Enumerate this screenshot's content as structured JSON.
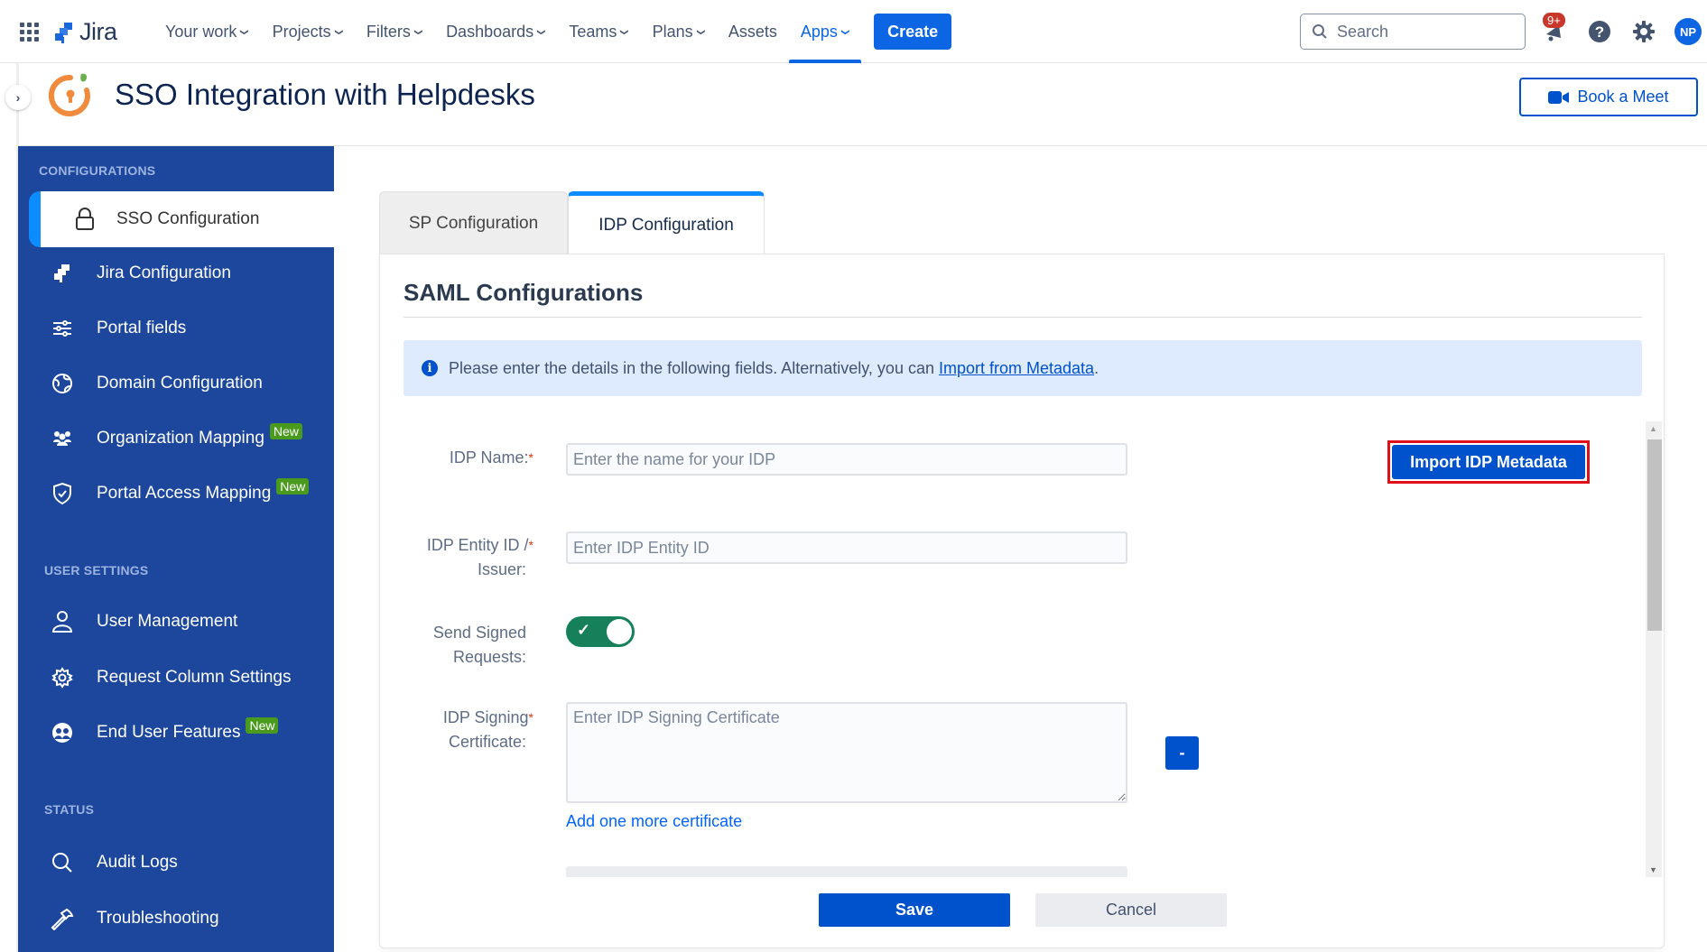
{
  "topnav": {
    "brand": "Jira",
    "items": [
      {
        "label": "Your work",
        "dropdown": true,
        "active": false
      },
      {
        "label": "Projects",
        "dropdown": true,
        "active": false
      },
      {
        "label": "Filters",
        "dropdown": true,
        "active": false
      },
      {
        "label": "Dashboards",
        "dropdown": true,
        "active": false
      },
      {
        "label": "Teams",
        "dropdown": true,
        "active": false
      },
      {
        "label": "Plans",
        "dropdown": true,
        "active": false
      },
      {
        "label": "Assets",
        "dropdown": false,
        "active": false
      },
      {
        "label": "Apps",
        "dropdown": true,
        "active": true
      }
    ],
    "create_label": "Create",
    "search_placeholder": "Search",
    "notifications_badge": "9+",
    "avatar_initials": "NP",
    "accent_color": "#0c66e4"
  },
  "app": {
    "title": "SSO Integration with Helpdesks",
    "book_meet_label": "Book a Meet"
  },
  "sidebar": {
    "sections": [
      {
        "title": "CONFIGURATIONS"
      },
      {
        "title": "USER SETTINGS"
      },
      {
        "title": "STATUS"
      }
    ],
    "items": [
      {
        "label": "SSO Configuration",
        "icon": "lock-icon",
        "active": true,
        "badge": null
      },
      {
        "label": "Jira Configuration",
        "icon": "jira-icon",
        "active": false,
        "badge": null
      },
      {
        "label": "Portal fields",
        "icon": "sliders-icon",
        "active": false,
        "badge": null
      },
      {
        "label": "Domain Configuration",
        "icon": "globe-icon",
        "active": false,
        "badge": null
      },
      {
        "label": "Organization Mapping",
        "icon": "users-group-icon",
        "active": false,
        "badge": "New"
      },
      {
        "label": "Portal Access Mapping",
        "icon": "shield-check-icon",
        "active": false,
        "badge": "New"
      },
      {
        "label": "User Management",
        "icon": "user-icon",
        "active": false,
        "badge": null
      },
      {
        "label": "Request Column Settings",
        "icon": "gear-icon",
        "active": false,
        "badge": null
      },
      {
        "label": "End User Features",
        "icon": "end-user-icon",
        "active": false,
        "badge": "New"
      },
      {
        "label": "Audit Logs",
        "icon": "search-icon",
        "active": false,
        "badge": null
      },
      {
        "label": "Troubleshooting",
        "icon": "hammer-icon",
        "active": false,
        "badge": null
      }
    ],
    "bg_color": "#1c479d",
    "badge_color": "#4a9b1d"
  },
  "tabs": [
    {
      "label": "SP Configuration",
      "active": false
    },
    {
      "label": "IDP Configuration",
      "active": true
    }
  ],
  "panel": {
    "title": "SAML Configurations",
    "info_text": "Please enter the details in the following fields. Alternatively, you can",
    "info_link": "Import from Metadata",
    "info_suffix": ".",
    "import_button": "Import IDP Metadata",
    "fields": {
      "idp_name": {
        "label": "IDP Name:",
        "required_mark": "*",
        "placeholder": "Enter the name for your IDP",
        "value": ""
      },
      "entity_id": {
        "label_line1": "IDP Entity ID /",
        "label_line2": "Issuer:",
        "required_mark": "*",
        "placeholder": "Enter IDP Entity ID",
        "value": ""
      },
      "signed_requests": {
        "label_line1": "Send Signed",
        "label_line2": "Requests:",
        "enabled": true
      },
      "signing_cert": {
        "label_line1": "IDP Signing",
        "label_line2": "Certificate:",
        "required_mark": "*",
        "placeholder": "Enter IDP Signing Certificate",
        "value": ""
      }
    },
    "remove_cert_label": "-",
    "add_cert_link": "Add one more certificate",
    "save_label": "Save",
    "cancel_label": "Cancel"
  }
}
